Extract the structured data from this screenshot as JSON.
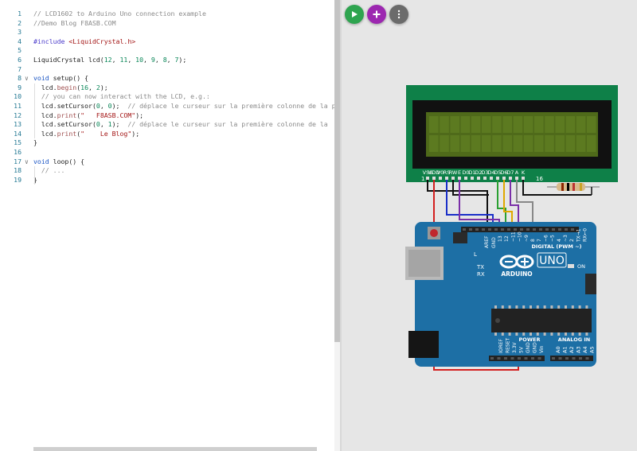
{
  "editor": {
    "lines": [
      {
        "n": "1",
        "fold": false,
        "parts": [
          {
            "c": "com",
            "t": "// LCD1602 to Arduino Uno connection example"
          }
        ]
      },
      {
        "n": "2",
        "fold": false,
        "parts": [
          {
            "c": "com",
            "t": "//Demo Blog F8ASB.COM"
          }
        ]
      },
      {
        "n": "3",
        "fold": false,
        "parts": []
      },
      {
        "n": "4",
        "fold": false,
        "parts": [
          {
            "c": "inc",
            "t": "#include "
          },
          {
            "c": "str",
            "t": "<LiquidCrystal.h>"
          }
        ]
      },
      {
        "n": "5",
        "fold": false,
        "parts": []
      },
      {
        "n": "6",
        "fold": false,
        "parts": [
          {
            "c": "txt",
            "t": "LiquidCrystal lcd("
          },
          {
            "c": "num",
            "t": "12"
          },
          {
            "c": "txt",
            "t": ", "
          },
          {
            "c": "num",
            "t": "11"
          },
          {
            "c": "txt",
            "t": ", "
          },
          {
            "c": "num",
            "t": "10"
          },
          {
            "c": "txt",
            "t": ", "
          },
          {
            "c": "num",
            "t": "9"
          },
          {
            "c": "txt",
            "t": ", "
          },
          {
            "c": "num",
            "t": "8"
          },
          {
            "c": "txt",
            "t": ", "
          },
          {
            "c": "num",
            "t": "7"
          },
          {
            "c": "txt",
            "t": ");"
          }
        ]
      },
      {
        "n": "7",
        "fold": false,
        "parts": []
      },
      {
        "n": "8",
        "fold": true,
        "parts": [
          {
            "c": "kw",
            "t": "void"
          },
          {
            "c": "txt",
            "t": " setup() {"
          }
        ]
      },
      {
        "n": "9",
        "fold": false,
        "parts": [
          {
            "c": "txt",
            "t": "  lcd."
          },
          {
            "c": "fn",
            "t": "begin"
          },
          {
            "c": "txt",
            "t": "("
          },
          {
            "c": "num",
            "t": "16"
          },
          {
            "c": "txt",
            "t": ", "
          },
          {
            "c": "num",
            "t": "2"
          },
          {
            "c": "txt",
            "t": ");"
          }
        ]
      },
      {
        "n": "10",
        "fold": false,
        "parts": [
          {
            "c": "com",
            "t": "  // you can now interact with the LCD, e.g.:"
          }
        ]
      },
      {
        "n": "11",
        "fold": false,
        "parts": [
          {
            "c": "txt",
            "t": "  lcd.setCursor("
          },
          {
            "c": "num",
            "t": "0"
          },
          {
            "c": "txt",
            "t": ", "
          },
          {
            "c": "num",
            "t": "0"
          },
          {
            "c": "txt",
            "t": ");  "
          },
          {
            "c": "com",
            "t": "// déplace le curseur sur la première colonne de la première ligne"
          }
        ]
      },
      {
        "n": "12",
        "fold": false,
        "parts": [
          {
            "c": "txt",
            "t": "  lcd."
          },
          {
            "c": "fn",
            "t": "print"
          },
          {
            "c": "txt",
            "t": "("
          },
          {
            "c": "str",
            "t": "\"   F8ASB.COM\""
          },
          {
            "c": "txt",
            "t": ");"
          }
        ]
      },
      {
        "n": "13",
        "fold": false,
        "parts": [
          {
            "c": "txt",
            "t": "  lcd.setCursor("
          },
          {
            "c": "num",
            "t": "0"
          },
          {
            "c": "txt",
            "t": ", "
          },
          {
            "c": "num",
            "t": "1"
          },
          {
            "c": "txt",
            "t": ");  "
          },
          {
            "c": "com",
            "t": "// déplace le curseur sur la première colonne de la"
          }
        ]
      },
      {
        "n": "14",
        "fold": false,
        "parts": [
          {
            "c": "txt",
            "t": "  lcd."
          },
          {
            "c": "fn",
            "t": "print"
          },
          {
            "c": "txt",
            "t": "("
          },
          {
            "c": "str",
            "t": "\"    Le Blog\""
          },
          {
            "c": "txt",
            "t": ");"
          }
        ]
      },
      {
        "n": "15",
        "fold": false,
        "parts": [
          {
            "c": "txt",
            "t": "}"
          }
        ]
      },
      {
        "n": "16",
        "fold": false,
        "parts": []
      },
      {
        "n": "17",
        "fold": true,
        "parts": [
          {
            "c": "kw",
            "t": "void"
          },
          {
            "c": "txt",
            "t": " loop() {"
          }
        ]
      },
      {
        "n": "18",
        "fold": false,
        "parts": [
          {
            "c": "com",
            "t": "  // ..."
          }
        ]
      },
      {
        "n": "19",
        "fold": false,
        "parts": [
          {
            "c": "txt",
            "t": "}"
          }
        ]
      }
    ]
  },
  "toolbar": {
    "run_icon": "play-icon",
    "add_icon": "plus-icon",
    "menu_icon": "more-vertical-icon",
    "colors": {
      "run": "#2ea44f",
      "add": "#9c27b0",
      "menu": "#6b6b6b"
    }
  },
  "lcd": {
    "pin_labels": [
      "VSS",
      "VDD",
      "V0",
      "RS",
      "RW",
      "E",
      "D0",
      "D1",
      "D2",
      "D3",
      "D4",
      "D5",
      "D6",
      "D7",
      "A",
      "K"
    ],
    "pin_first": "1",
    "pin_last": "16",
    "colors": {
      "pcb": "#0e8048",
      "bezel": "#111111",
      "screen": "#4f6a1a"
    }
  },
  "arduino": {
    "brand": "ARDUINO",
    "model": "UNO",
    "on_label": "ON",
    "l_label": "L",
    "tx_label": "TX",
    "rx_label": "RX",
    "aref_label": "AREF",
    "gnd_label": "GND",
    "digital_label": "DIGITAL (PWM ~)",
    "digital_pins": [
      "13",
      "12",
      "~11",
      "~10",
      "~9",
      "8",
      "7",
      "~6",
      "~5",
      "4",
      "~3",
      "2",
      "TX→1",
      "RX←0"
    ],
    "power_header": "POWER",
    "analog_header": "ANALOG IN",
    "power_pins": [
      "IOREF",
      "RESET",
      "3.3V",
      "5V",
      "GND",
      "GND",
      "Vin"
    ],
    "analog_pins": [
      "A0",
      "A1",
      "A2",
      "A3",
      "A4",
      "A5"
    ],
    "colors": {
      "board": "#1d6fa5",
      "dark": "#175c8a"
    }
  }
}
